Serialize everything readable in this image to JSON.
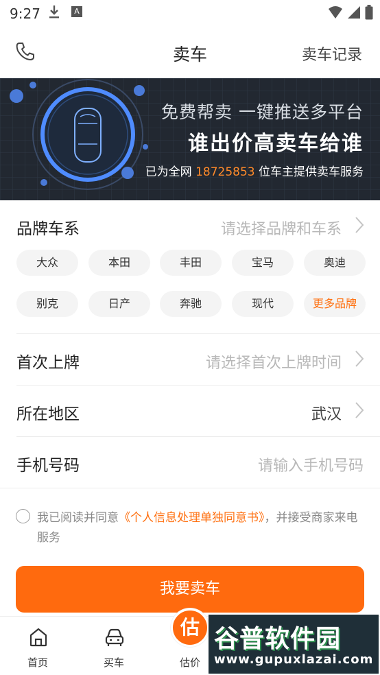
{
  "status_bar": {
    "time": "9:27",
    "a_glyph": "A"
  },
  "header": {
    "title": "卖车",
    "record_link": "卖车记录",
    "phone_icon": "phone-icon"
  },
  "banner": {
    "line1": "免费帮卖 一键推送多平台",
    "line2": "谁出价高卖车给谁",
    "line3_prefix": "已为全网",
    "line3_number": "18725853",
    "line3_suffix": "位车主提供卖车服务"
  },
  "brand": {
    "label": "品牌车系",
    "placeholder": "请选择品牌和车系",
    "chips": [
      "大众",
      "本田",
      "丰田",
      "宝马",
      "奥迪",
      "别克",
      "日产",
      "奔驰",
      "现代",
      "更多品牌"
    ]
  },
  "first_plate": {
    "label": "首次上牌",
    "placeholder": "请选择首次上牌时间"
  },
  "region": {
    "label": "所在地区",
    "value": "武汉"
  },
  "phone": {
    "label": "手机号码",
    "placeholder": "请输入手机号码"
  },
  "agreement": {
    "prefix": "我已阅读并同意",
    "link": "《个人信息处理单独同意书》",
    "suffix": "，并接受商家来电服务"
  },
  "submit": {
    "label": "我要卖车"
  },
  "bottom_nav": {
    "home": "首页",
    "sell": "买车",
    "estimate": "估价",
    "estimate_badge": "估"
  },
  "watermark": {
    "title": "谷普软件园",
    "url": "www.gupuxlazai.com"
  },
  "colors": {
    "accent": "#ff6a0e",
    "banner_bg": "#222831",
    "banner_number": "#ff8a2a"
  }
}
